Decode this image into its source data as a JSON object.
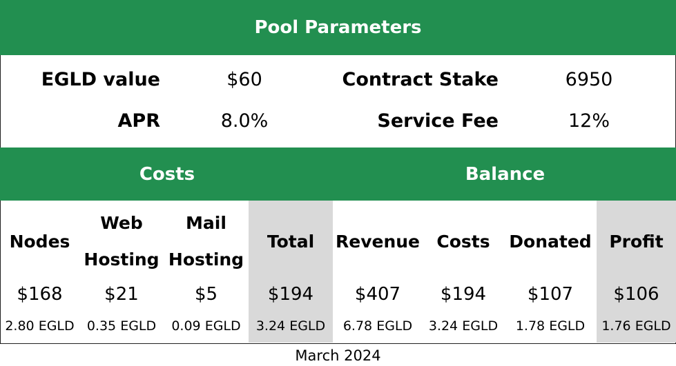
{
  "header": {
    "title": "Pool Parameters"
  },
  "parameters": {
    "egld_value_label": "EGLD value",
    "egld_value": "$60",
    "contract_stake_label": "Contract Stake",
    "contract_stake": "6950",
    "apr_label": "APR",
    "apr": "8.0%",
    "service_fee_label": "Service Fee",
    "service_fee": "12%"
  },
  "sections": {
    "costs": "Costs",
    "balance": "Balance"
  },
  "columns": [
    {
      "line1": "Nodes",
      "line2": "",
      "usd": "$168",
      "egld": "2.80 EGLD",
      "highlight": false
    },
    {
      "line1": "Web",
      "line2": "Hosting",
      "usd": "$21",
      "egld": "0.35 EGLD",
      "highlight": false
    },
    {
      "line1": "Mail",
      "line2": "Hosting",
      "usd": "$5",
      "egld": "0.09 EGLD",
      "highlight": false
    },
    {
      "line1": "Total",
      "line2": "",
      "usd": "$194",
      "egld": "3.24 EGLD",
      "highlight": true
    },
    {
      "line1": "Revenue",
      "line2": "",
      "usd": "$407",
      "egld": "6.78 EGLD",
      "highlight": false
    },
    {
      "line1": "Costs",
      "line2": "",
      "usd": "$194",
      "egld": "3.24 EGLD",
      "highlight": false
    },
    {
      "line1": "Donated",
      "line2": "",
      "usd": "$107",
      "egld": "1.78 EGLD",
      "highlight": false
    },
    {
      "line1": "Profit",
      "line2": "",
      "usd": "$106",
      "egld": "1.76 EGLD",
      "highlight": true
    }
  ],
  "footer": {
    "period": "March 2024"
  },
  "colors": {
    "brand_green": "#228f50",
    "highlight_gray": "#d9d9d9",
    "text": "#000000",
    "header_text": "#ffffff"
  }
}
